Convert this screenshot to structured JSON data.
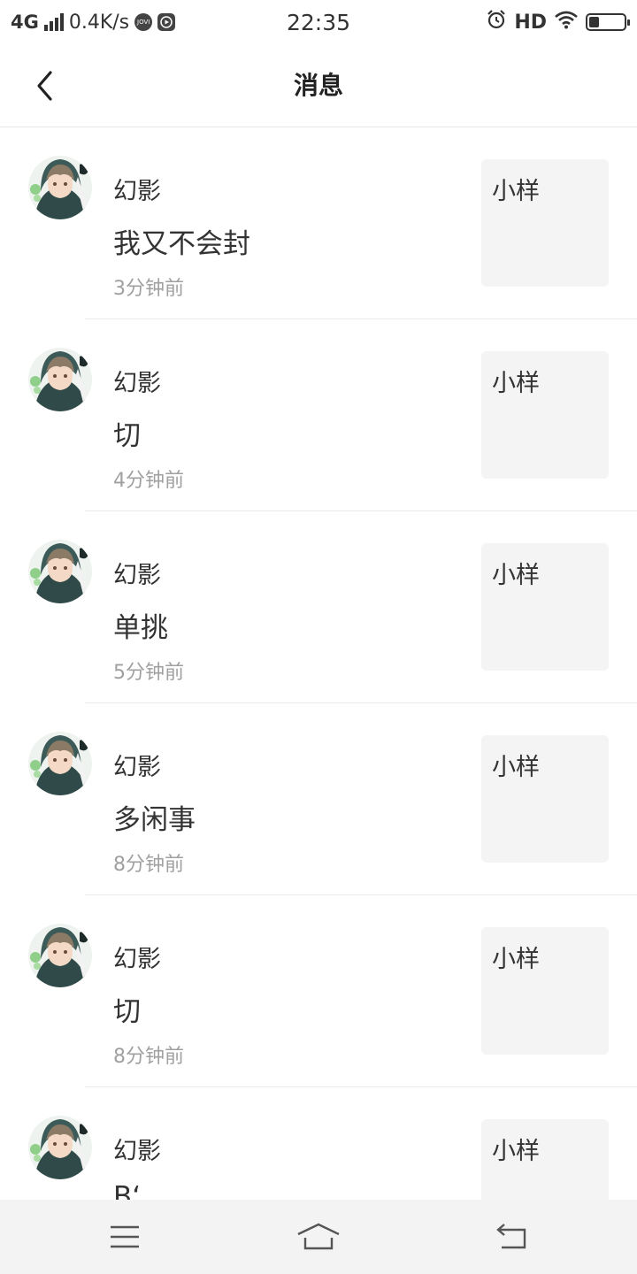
{
  "status_bar": {
    "network": "4G",
    "speed": "0.4K/s",
    "jovi_icon_text": "JOVI",
    "time": "22:35",
    "hd": "HD",
    "battery_level": 0.3
  },
  "nav": {
    "title": "消息"
  },
  "messages": [
    {
      "name": "幻影",
      "text": "我又不会封",
      "time": "3分钟前",
      "ref": "小样"
    },
    {
      "name": "幻影",
      "text": "切",
      "time": "4分钟前",
      "ref": "小样"
    },
    {
      "name": "幻影",
      "text": "单挑",
      "time": "5分钟前",
      "ref": "小样"
    },
    {
      "name": "幻影",
      "text": "多闲事",
      "time": "8分钟前",
      "ref": "小样"
    },
    {
      "name": "幻影",
      "text": "切",
      "time": "8分钟前",
      "ref": "小样"
    },
    {
      "name": "幻影",
      "text": "B‘",
      "time": "",
      "ref": "小样"
    }
  ],
  "icons": {
    "back": "chevron-left-icon",
    "menu": "menu-icon",
    "home": "home-icon",
    "return": "back-arrow-icon"
  },
  "colors": {
    "background": "#ffffff",
    "ref_box": "#f4f4f4",
    "time_text": "#a0a0a0",
    "sys_nav": "#f3f3f3"
  }
}
